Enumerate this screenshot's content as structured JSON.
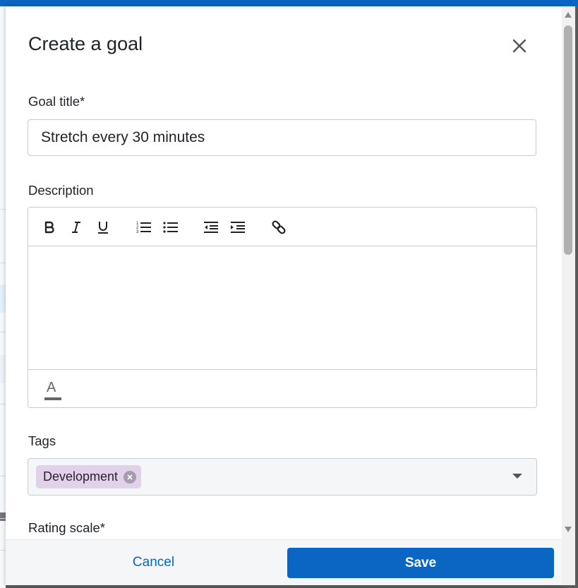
{
  "dialog": {
    "title": "Create a goal",
    "close_icon": "close-icon"
  },
  "goal_title": {
    "label": "Goal title*",
    "value": "Stretch every 30 minutes",
    "placeholder": ""
  },
  "description": {
    "label": "Description",
    "toolbar_icons": [
      "bold-icon",
      "italic-icon",
      "underline-icon",
      "numbered-list-icon",
      "bullet-list-icon",
      "outdent-icon",
      "indent-icon",
      "link-icon"
    ],
    "text_color_glyph": "A",
    "value": ""
  },
  "tags": {
    "label": "Tags",
    "selected": [
      {
        "label": "Development"
      }
    ]
  },
  "rating_scale": {
    "label": "Rating scale*"
  },
  "actions": {
    "cancel_label": "Cancel",
    "save_label": "Save"
  },
  "colors": {
    "accent": "#0a66c2",
    "tag_chip": "#e0d2e8",
    "border": "#c9cdd3",
    "text": "#1f2328"
  }
}
